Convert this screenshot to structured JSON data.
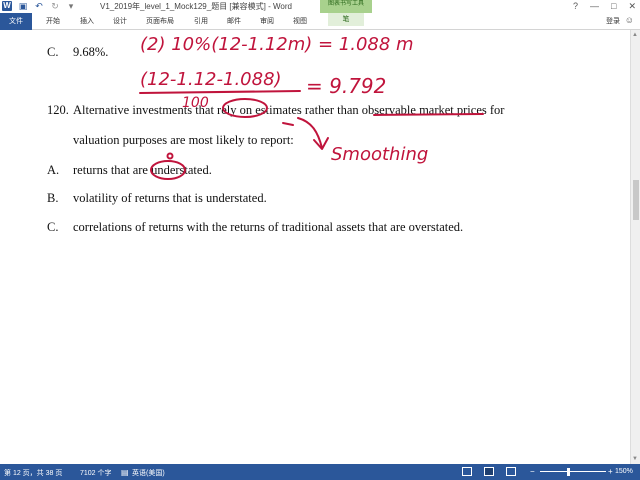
{
  "window": {
    "title": "V1_2019年_level_1_Mock129_题目 [兼容模式] - Word",
    "contextual_group": "图表书写工具",
    "controls": [
      "?",
      "—",
      "□",
      "✕"
    ]
  },
  "ribbon": {
    "tabs": [
      "文件",
      "开始",
      "插入",
      "设计",
      "页面布局",
      "引用",
      "邮件",
      "审阅",
      "视图",
      "笔"
    ],
    "login": "登录"
  },
  "document": {
    "prev_option": {
      "letter": "C.",
      "text": "9.68%."
    },
    "question": {
      "number": "120.",
      "line1": "Alternative investments that rely on estimates rather than observable market prices for",
      "line2": "valuation purposes are most likely to report:"
    },
    "options": [
      {
        "letter": "A.",
        "text": "returns that are understated."
      },
      {
        "letter": "B.",
        "text": "volatility of returns that is understated."
      },
      {
        "letter": "C.",
        "text": "correlations of returns with the returns of traditional assets that are overstated."
      }
    ],
    "handwriting": {
      "top_line": "(2) 10%(12-1.12m) = 1.088 m",
      "numerator": "(12-1.12-1.088)",
      "denominator": "100",
      "result": "= 9.792",
      "note": "Smoothing"
    }
  },
  "statusbar": {
    "page": "第 12 页，共 38 页",
    "words": "7102 个字",
    "language": "英语(美国)",
    "zoom": "150%"
  },
  "colors": {
    "accent": "#2b579a",
    "ink": "#c0143c"
  }
}
